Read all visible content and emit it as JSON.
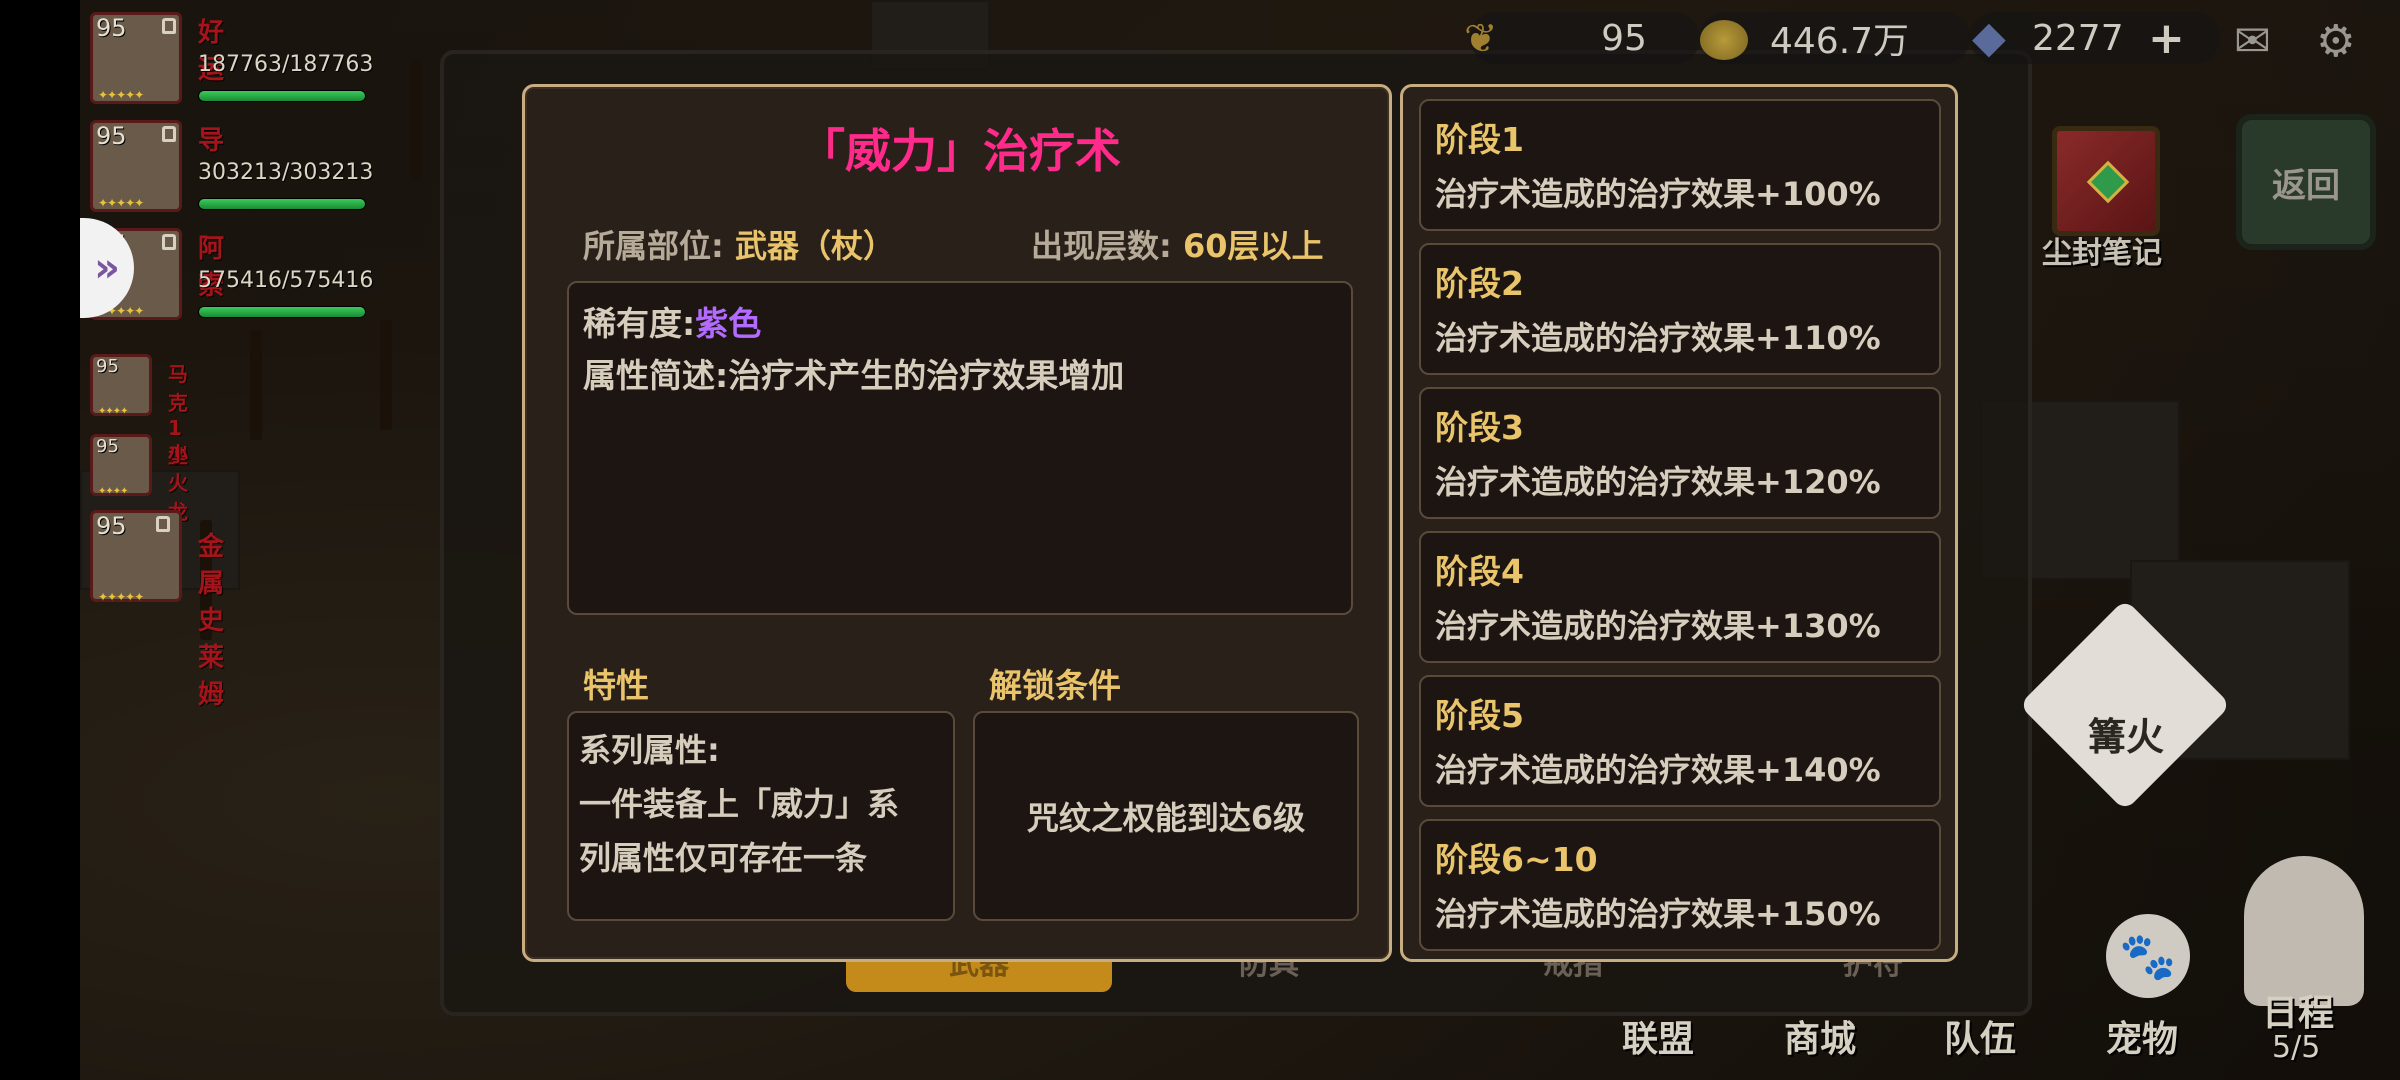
{
  "party": [
    {
      "level": "95",
      "name": "好运",
      "hp": "187763/187763",
      "hp_fraction": 1.0
    },
    {
      "level": "95",
      "name": "导",
      "hp": "303213/303213",
      "hp_fraction": 1.0
    },
    {
      "level": "95",
      "name": "阿索",
      "hp": "575416/575416",
      "hp_fraction": 1.0
    },
    {
      "level": "95",
      "name": "马克1型"
    },
    {
      "level": "95",
      "name": "小火龙"
    },
    {
      "level": "95",
      "name": "金属史莱姆"
    }
  ],
  "resources": {
    "wheat": "95",
    "gold": "446.7万",
    "diamond": "2277",
    "add_symbol": "+"
  },
  "right_buttons": {
    "dusty_notes": "尘封笔记",
    "back": "返回",
    "bonfire": "篝火"
  },
  "bottom_nav": {
    "alliance": "联盟",
    "shop": "商城",
    "team": "队伍",
    "pet": "宠物",
    "schedule": "日程",
    "schedule_count": "5/5"
  },
  "background_tabs": [
    "武器",
    "防具",
    "戒指",
    "护符"
  ],
  "dialog": {
    "title": "「威力」治疗术",
    "slot_label": "所属部位:",
    "slot_value": "武器（杖）",
    "floor_label": "出现层数:",
    "floor_value": "60层以上",
    "rarity_label": "稀有度:",
    "rarity_value": "紫色",
    "attr_label": "属性简述:",
    "attr_value": "治疗术产生的治疗效果增加",
    "trait_title": "特性",
    "unlock_title": "解锁条件",
    "trait_lines": [
      "系列属性:",
      "一件装备上「威力」系",
      "列属性仅可存在一条"
    ],
    "unlock_text": "咒纹之权能到达6级"
  },
  "stages": [
    {
      "name": "阶段1",
      "effect": "治疗术造成的治疗效果+100%"
    },
    {
      "name": "阶段2",
      "effect": "治疗术造成的治疗效果+110%"
    },
    {
      "name": "阶段3",
      "effect": "治疗术造成的治疗效果+120%"
    },
    {
      "name": "阶段4",
      "effect": "治疗术造成的治疗效果+130%"
    },
    {
      "name": "阶段5",
      "effect": "治疗术造成的治疗效果+140%"
    },
    {
      "name": "阶段6~10",
      "effect": "治疗术造成的治疗效果+150%"
    }
  ],
  "colors": {
    "title": "#ff2a8a",
    "gold_text": "#e9c46a",
    "rarity_purple": "#b36bff",
    "panel_border": "#c9ad82"
  }
}
